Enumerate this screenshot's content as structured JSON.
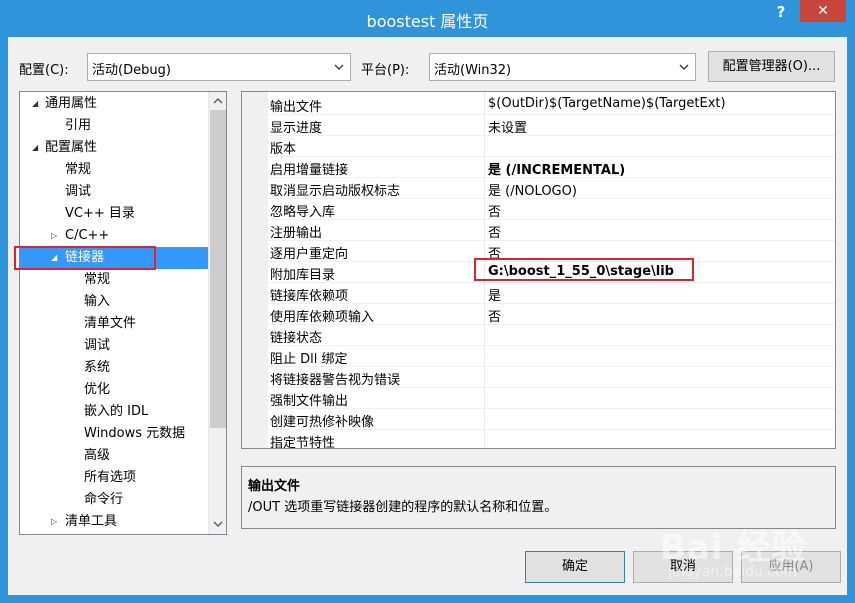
{
  "window": {
    "title": "boostest 属性页",
    "help": "?",
    "close": "✕"
  },
  "toolbar": {
    "config_label": "配置(C):",
    "config_value": "活动(Debug)",
    "platform_label": "平台(P):",
    "platform_value": "活动(Win32)",
    "config_manager": "配置管理器(O)..."
  },
  "tree": {
    "items": [
      {
        "label": "通用属性",
        "toggle": "◢"
      },
      {
        "label": "引用",
        "toggle": ""
      },
      {
        "label": "配置属性",
        "toggle": "◢"
      },
      {
        "label": "常规",
        "toggle": ""
      },
      {
        "label": "调试",
        "toggle": ""
      },
      {
        "label": "VC++ 目录",
        "toggle": ""
      },
      {
        "label": "C/C++",
        "toggle": "▷"
      },
      {
        "label": "链接器",
        "toggle": "◢"
      },
      {
        "label": "常规",
        "toggle": ""
      },
      {
        "label": "输入",
        "toggle": ""
      },
      {
        "label": "清单文件",
        "toggle": ""
      },
      {
        "label": "调试",
        "toggle": ""
      },
      {
        "label": "系统",
        "toggle": ""
      },
      {
        "label": "优化",
        "toggle": ""
      },
      {
        "label": "嵌入的 IDL",
        "toggle": ""
      },
      {
        "label": "Windows 元数据",
        "toggle": ""
      },
      {
        "label": "高级",
        "toggle": ""
      },
      {
        "label": "所有选项",
        "toggle": ""
      },
      {
        "label": "命令行",
        "toggle": ""
      },
      {
        "label": "清单工具",
        "toggle": "▷"
      }
    ]
  },
  "grid": {
    "rows": [
      {
        "name": "输出文件",
        "value": "$(OutDir)$(TargetName)$(TargetExt)"
      },
      {
        "name": "显示进度",
        "value": "未设置"
      },
      {
        "name": "版本",
        "value": ""
      },
      {
        "name": "启用增量链接",
        "value": "是 (/INCREMENTAL)"
      },
      {
        "name": "取消显示启动版权标志",
        "value": "是 (/NOLOGO)"
      },
      {
        "name": "忽略导入库",
        "value": "否"
      },
      {
        "name": "注册输出",
        "value": "否"
      },
      {
        "name": "逐用户重定向",
        "value": "否"
      },
      {
        "name": "附加库目录",
        "value": "G:\\boost_1_55_0\\stage\\lib"
      },
      {
        "name": "链接库依赖项",
        "value": "是"
      },
      {
        "name": "使用库依赖项输入",
        "value": "否"
      },
      {
        "name": "链接状态",
        "value": ""
      },
      {
        "name": "阻止 Dll 绑定",
        "value": ""
      },
      {
        "name": "将链接器警告视为错误",
        "value": ""
      },
      {
        "name": "强制文件输出",
        "value": ""
      },
      {
        "name": "创建可热修补映像",
        "value": ""
      },
      {
        "name": "指定节特性",
        "value": ""
      }
    ]
  },
  "description": {
    "title": "输出文件",
    "text": "/OUT 选项重写链接器创建的程序的默认名称和位置。"
  },
  "buttons": {
    "ok": "确定",
    "cancel": "取消",
    "apply": "应用(A)"
  },
  "watermark": {
    "logo": "Bai 经验",
    "url": "jingyan.baidu.com"
  },
  "colors": {
    "titlebar": "#2f94da",
    "selection": "#3399ff",
    "highlight_box": "#d8262f",
    "close_button": "#c7453b"
  }
}
